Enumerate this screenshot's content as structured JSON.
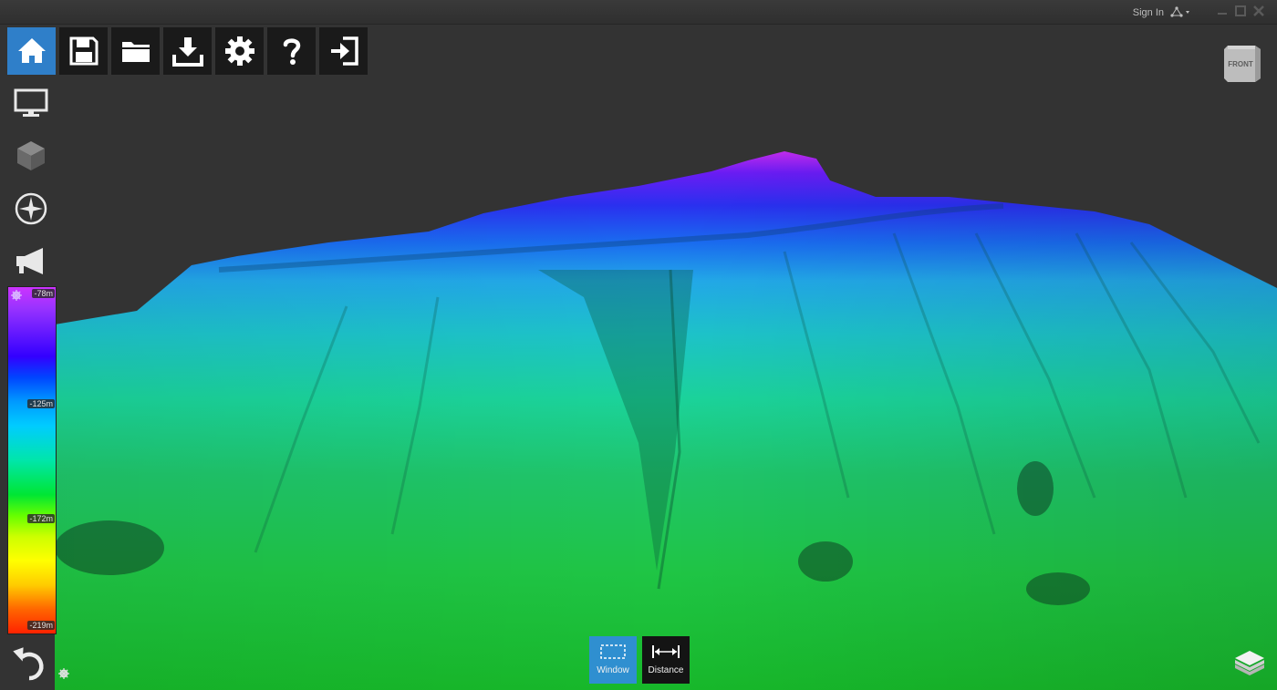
{
  "titlebar": {
    "sign_in": "Sign In",
    "icons": [
      "network-icon",
      "minimize-icon",
      "maximize-icon",
      "close-icon"
    ]
  },
  "toolbar": {
    "buttons": [
      {
        "name": "home",
        "icon": "home-icon",
        "active": true
      },
      {
        "name": "save",
        "icon": "save-icon"
      },
      {
        "name": "open",
        "icon": "folder-icon"
      },
      {
        "name": "download",
        "icon": "download-icon"
      },
      {
        "name": "settings",
        "icon": "gear-icon"
      },
      {
        "name": "help",
        "icon": "help-icon"
      },
      {
        "name": "exit",
        "icon": "exit-icon"
      }
    ]
  },
  "side_tools": [
    "monitor-icon",
    "cube-icon",
    "compass-icon",
    "megaphone-icon"
  ],
  "legend": {
    "ticks": [
      "-78m",
      "-125m",
      "-172m",
      "-219m"
    ]
  },
  "viewcube": {
    "label": "FRONT"
  },
  "bottom_tools": {
    "window_label": "Window",
    "distance_label": "Distance"
  },
  "colors": {
    "accent": "#2f7fc9",
    "toolbar_bg": "#1a1a1a",
    "background": "#333333"
  }
}
